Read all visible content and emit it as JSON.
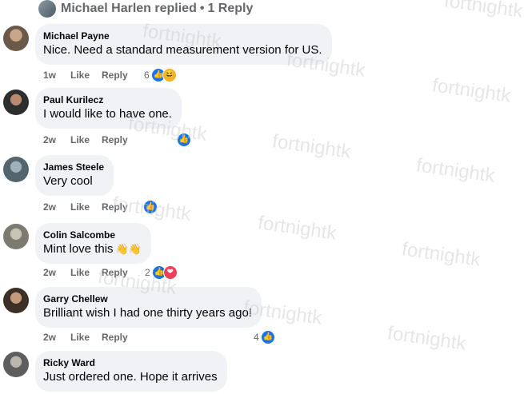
{
  "header": {
    "replied_text": "Michael Harlen replied",
    "separator": "•",
    "reply_count": "1 Reply"
  },
  "watermark": "fortnightk",
  "comments": [
    {
      "name": "Michael Payne",
      "text": "Nice. Need a standard measurement version for US.",
      "time": "1w",
      "like": "Like",
      "reply": "Reply",
      "reaction_count": "6",
      "reactions": [
        "like-icon",
        "haha-icon"
      ],
      "avatar_color": "#6b5a4a"
    },
    {
      "name": "Paul Kurilecz",
      "text": "I would like to have one.",
      "time": "2w",
      "like": "Like",
      "reply": "Reply",
      "reaction_count": "",
      "reactions": [
        "like-icon"
      ],
      "avatar_color": "#3c3c3c"
    },
    {
      "name": "James Steele",
      "text": "Very cool",
      "time": "2w",
      "like": "Like",
      "reply": "Reply",
      "reaction_count": "",
      "reactions": [
        "like-icon"
      ],
      "avatar_color": "#6d7f89"
    },
    {
      "name": "Colin Salcombe",
      "text": "Mint love this",
      "emoji": "👋👋",
      "time": "2w",
      "like": "Like",
      "reply": "Reply",
      "reaction_count": "2",
      "reactions": [
        "like-icon",
        "love-icon"
      ],
      "avatar_color": "#8b8a80"
    },
    {
      "name": "Garry Chellew",
      "text": "Brilliant wish I had one thirty years ago!",
      "time": "2w",
      "like": "Like",
      "reply": "Reply",
      "reaction_count": "4",
      "reactions": [
        "like-icon"
      ],
      "avatar_color": "#4a3a2e"
    },
    {
      "name": "Ricky Ward",
      "text": "Just ordered one. Hope it arrives",
      "time": "",
      "like": "",
      "reply": "",
      "reaction_count": "",
      "reactions": [],
      "avatar_color": "#6a6a6a"
    }
  ],
  "colors": {
    "like": "#1b74e4",
    "love": "#f33e58",
    "haha": "#f7b125",
    "bubble": "#f0f2f5",
    "meta": "#65676b"
  }
}
